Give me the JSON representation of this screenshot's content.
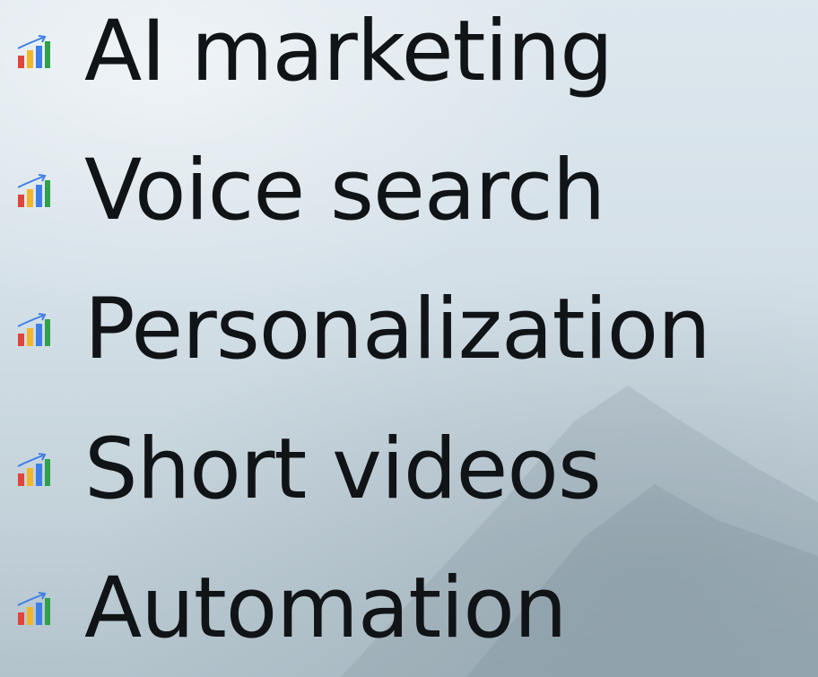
{
  "items": [
    {
      "label": "AI marketing",
      "icon": "chart-increasing-icon"
    },
    {
      "label": "Voice search",
      "icon": "chart-increasing-icon"
    },
    {
      "label": "Personalization",
      "icon": "chart-increasing-icon"
    },
    {
      "label": "Short videos",
      "icon": "chart-increasing-icon"
    },
    {
      "label": "Automation",
      "icon": "chart-increasing-icon"
    }
  ],
  "colors": {
    "text": "#111417",
    "icon_bar_red": "#e0443a",
    "icon_bar_yellow": "#f2b62b",
    "icon_bar_blue": "#3d7ee8",
    "icon_bar_green": "#2fa14a",
    "icon_trend": "#3d7ee8"
  }
}
